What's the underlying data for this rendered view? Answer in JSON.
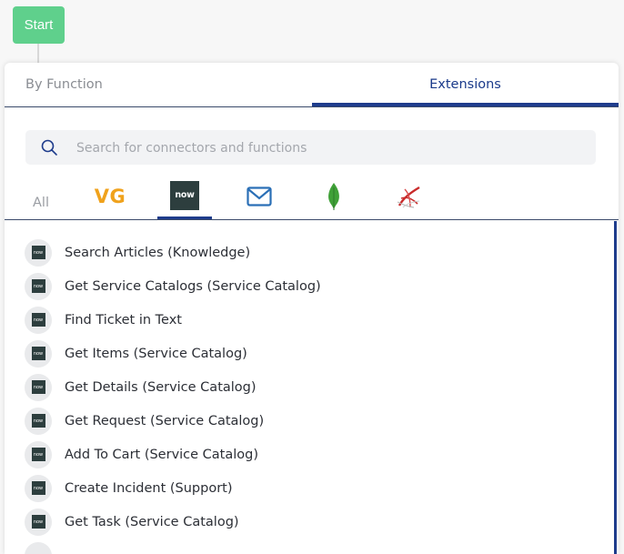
{
  "flow": {
    "start_label": "Start"
  },
  "tabs": {
    "by_function": "By Function",
    "extensions": "Extensions"
  },
  "search": {
    "placeholder": "Search for connectors and functions",
    "value": ""
  },
  "ext_tabs": {
    "all": "All",
    "vg": "VG",
    "now": "now",
    "items": [
      "vg-icon",
      "servicenow-icon",
      "mail-icon",
      "mongodb-icon",
      "sql-server-icon"
    ],
    "selected": "servicenow"
  },
  "colors": {
    "start_green": "#5fd08c",
    "accent_blue": "#1e3c8c",
    "vg_orange": "#f0a21c",
    "now_dark": "#2d3e3e",
    "mongo_green": "#3fa037",
    "mail_blue": "#2a6fb6"
  },
  "functions": [
    "Search Articles (Knowledge)",
    "Get Service Catalogs (Service Catalog)",
    "Find Ticket in Text",
    "Get Items (Service Catalog)",
    "Get Details (Service Catalog)",
    "Get Request (Service Catalog)",
    "Add To Cart (Service Catalog)",
    "Create Incident (Support)",
    "Get Task (Service Catalog)"
  ]
}
